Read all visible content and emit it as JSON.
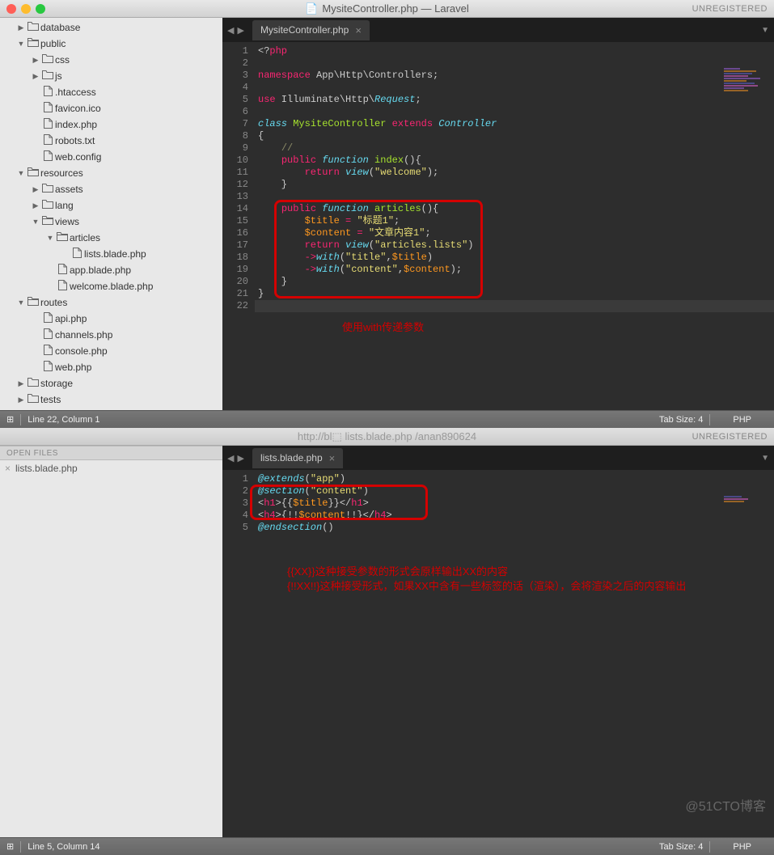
{
  "window1": {
    "title": "MysiteController.php — Laravel",
    "registration": "UNREGISTERED",
    "tab": "MysiteController.php",
    "statusbar": {
      "pos": "Line 22, Column 1",
      "tabsize": "Tab Size: 4",
      "lang": "PHP"
    },
    "annotation": "使用with传递参数",
    "tree": [
      {
        "ind": 1,
        "arrow": "▶",
        "icon": "folder",
        "label": "database"
      },
      {
        "ind": 1,
        "arrow": "▼",
        "icon": "folder-open",
        "label": "public"
      },
      {
        "ind": 2,
        "arrow": "▶",
        "icon": "folder",
        "label": "css"
      },
      {
        "ind": 2,
        "arrow": "▶",
        "icon": "folder",
        "label": "js"
      },
      {
        "ind": 2,
        "arrow": "",
        "icon": "file",
        "label": ".htaccess"
      },
      {
        "ind": 2,
        "arrow": "",
        "icon": "file",
        "label": "favicon.ico"
      },
      {
        "ind": 2,
        "arrow": "",
        "icon": "file",
        "label": "index.php"
      },
      {
        "ind": 2,
        "arrow": "",
        "icon": "file",
        "label": "robots.txt"
      },
      {
        "ind": 2,
        "arrow": "",
        "icon": "file",
        "label": "web.config"
      },
      {
        "ind": 1,
        "arrow": "▼",
        "icon": "folder-open",
        "label": "resources"
      },
      {
        "ind": 2,
        "arrow": "▶",
        "icon": "folder",
        "label": "assets"
      },
      {
        "ind": 2,
        "arrow": "▶",
        "icon": "folder",
        "label": "lang"
      },
      {
        "ind": 2,
        "arrow": "▼",
        "icon": "folder-open",
        "label": "views"
      },
      {
        "ind": 3,
        "arrow": "▼",
        "icon": "folder-open",
        "label": "articles"
      },
      {
        "ind": 4,
        "arrow": "",
        "icon": "file",
        "label": "lists.blade.php"
      },
      {
        "ind": 3,
        "arrow": "",
        "icon": "file",
        "label": "app.blade.php"
      },
      {
        "ind": 3,
        "arrow": "",
        "icon": "file",
        "label": "welcome.blade.php"
      },
      {
        "ind": 1,
        "arrow": "▼",
        "icon": "folder-open",
        "label": "routes"
      },
      {
        "ind": 2,
        "arrow": "",
        "icon": "file",
        "label": "api.php"
      },
      {
        "ind": 2,
        "arrow": "",
        "icon": "file",
        "label": "channels.php"
      },
      {
        "ind": 2,
        "arrow": "",
        "icon": "file",
        "label": "console.php"
      },
      {
        "ind": 2,
        "arrow": "",
        "icon": "file",
        "label": "web.php"
      },
      {
        "ind": 1,
        "arrow": "▶",
        "icon": "folder",
        "label": "storage"
      },
      {
        "ind": 1,
        "arrow": "▶",
        "icon": "folder",
        "label": "tests"
      }
    ],
    "code": {
      "line_count": 22,
      "lines": [
        {
          "n": 1,
          "tokens": [
            {
              "c": "punct",
              "t": "<?"
            },
            {
              "c": "kw-red",
              "t": "php"
            }
          ]
        },
        {
          "n": 2,
          "tokens": []
        },
        {
          "n": 3,
          "tokens": [
            {
              "c": "kw-red",
              "t": "namespace"
            },
            {
              "c": "punct",
              "t": " App\\Http\\Controllers;"
            }
          ]
        },
        {
          "n": 4,
          "tokens": []
        },
        {
          "n": 5,
          "tokens": [
            {
              "c": "kw-red",
              "t": "use"
            },
            {
              "c": "punct",
              "t": " Illuminate\\Http\\"
            },
            {
              "c": "kw-blue",
              "t": "Request"
            },
            {
              "c": "punct",
              "t": ";"
            }
          ]
        },
        {
          "n": 6,
          "tokens": []
        },
        {
          "n": 7,
          "tokens": [
            {
              "c": "kw-blue",
              "t": "class"
            },
            {
              "c": "punct",
              "t": " "
            },
            {
              "c": "kw-green",
              "t": "MysiteController"
            },
            {
              "c": "punct",
              "t": " "
            },
            {
              "c": "kw-red",
              "t": "extends"
            },
            {
              "c": "punct",
              "t": " "
            },
            {
              "c": "kw-blue",
              "t": "Controller"
            }
          ]
        },
        {
          "n": 8,
          "tokens": [
            {
              "c": "punct",
              "t": "{"
            }
          ]
        },
        {
          "n": 9,
          "tokens": [
            {
              "c": "punct",
              "t": "    "
            },
            {
              "c": "comment",
              "t": "//"
            }
          ]
        },
        {
          "n": 10,
          "tokens": [
            {
              "c": "punct",
              "t": "    "
            },
            {
              "c": "kw-red",
              "t": "public"
            },
            {
              "c": "punct",
              "t": " "
            },
            {
              "c": "kw-blue",
              "t": "function"
            },
            {
              "c": "punct",
              "t": " "
            },
            {
              "c": "kw-green",
              "t": "index"
            },
            {
              "c": "punct",
              "t": "(){"
            }
          ]
        },
        {
          "n": 11,
          "tokens": [
            {
              "c": "punct",
              "t": "        "
            },
            {
              "c": "kw-red",
              "t": "return"
            },
            {
              "c": "punct",
              "t": " "
            },
            {
              "c": "kw-blue",
              "t": "view"
            },
            {
              "c": "punct",
              "t": "("
            },
            {
              "c": "str",
              "t": "\"welcome\""
            },
            {
              "c": "punct",
              "t": ");"
            }
          ]
        },
        {
          "n": 12,
          "tokens": [
            {
              "c": "punct",
              "t": "    }"
            }
          ]
        },
        {
          "n": 13,
          "tokens": []
        },
        {
          "n": 14,
          "tokens": [
            {
              "c": "punct",
              "t": "    "
            },
            {
              "c": "kw-red",
              "t": "public"
            },
            {
              "c": "punct",
              "t": " "
            },
            {
              "c": "kw-blue",
              "t": "function"
            },
            {
              "c": "punct",
              "t": " "
            },
            {
              "c": "kw-green",
              "t": "articles"
            },
            {
              "c": "punct",
              "t": "(){"
            }
          ]
        },
        {
          "n": 15,
          "tokens": [
            {
              "c": "punct",
              "t": "        "
            },
            {
              "c": "num-var",
              "t": "$title"
            },
            {
              "c": "punct",
              "t": " "
            },
            {
              "c": "kw-red",
              "t": "="
            },
            {
              "c": "punct",
              "t": " "
            },
            {
              "c": "str",
              "t": "\"标题1\""
            },
            {
              "c": "punct",
              "t": ";"
            }
          ]
        },
        {
          "n": 16,
          "tokens": [
            {
              "c": "punct",
              "t": "        "
            },
            {
              "c": "num-var",
              "t": "$content"
            },
            {
              "c": "punct",
              "t": " "
            },
            {
              "c": "kw-red",
              "t": "="
            },
            {
              "c": "punct",
              "t": " "
            },
            {
              "c": "str",
              "t": "\"文章内容1\""
            },
            {
              "c": "punct",
              "t": ";"
            }
          ]
        },
        {
          "n": 17,
          "tokens": [
            {
              "c": "punct",
              "t": "        "
            },
            {
              "c": "kw-red",
              "t": "return"
            },
            {
              "c": "punct",
              "t": " "
            },
            {
              "c": "kw-blue",
              "t": "view"
            },
            {
              "c": "punct",
              "t": "("
            },
            {
              "c": "str",
              "t": "\"articles.lists\""
            },
            {
              "c": "punct",
              "t": ")"
            }
          ]
        },
        {
          "n": 18,
          "tokens": [
            {
              "c": "punct",
              "t": "        "
            },
            {
              "c": "kw-red",
              "t": "->"
            },
            {
              "c": "kw-blue",
              "t": "with"
            },
            {
              "c": "punct",
              "t": "("
            },
            {
              "c": "str",
              "t": "\"title\""
            },
            {
              "c": "punct",
              "t": ","
            },
            {
              "c": "num-var",
              "t": "$title"
            },
            {
              "c": "punct",
              "t": ")"
            }
          ]
        },
        {
          "n": 19,
          "tokens": [
            {
              "c": "punct",
              "t": "        "
            },
            {
              "c": "kw-red",
              "t": "->"
            },
            {
              "c": "kw-blue",
              "t": "with"
            },
            {
              "c": "punct",
              "t": "("
            },
            {
              "c": "str",
              "t": "\"content\""
            },
            {
              "c": "punct",
              "t": ","
            },
            {
              "c": "num-var",
              "t": "$content"
            },
            {
              "c": "punct",
              "t": ");"
            }
          ]
        },
        {
          "n": 20,
          "tokens": [
            {
              "c": "punct",
              "t": "    }"
            }
          ]
        },
        {
          "n": 21,
          "tokens": [
            {
              "c": "punct",
              "t": "}"
            }
          ]
        },
        {
          "n": 22,
          "tokens": [],
          "active": true
        }
      ]
    }
  },
  "window2": {
    "title_ghost": "http://bl⬚ lists.blade.php /anan890624",
    "registration": "UNREGISTERED",
    "openfiles_header": "OPEN FILES",
    "openfile": "lists.blade.php",
    "tab": "lists.blade.php",
    "statusbar": {
      "pos": "Line 5, Column 14",
      "tabsize": "Tab Size: 4",
      "lang": "PHP"
    },
    "annotations": [
      "{{XX}}这种接受参数的形式会原样输出XX的内容",
      "{!!XX!!}这种接受形式，如果XX中含有一些标签的话（渲染），会将渲染之后的内容输出"
    ],
    "watermark": "@51CTO博客",
    "code": {
      "line_count": 5,
      "lines": [
        {
          "n": 1,
          "tokens": [
            {
              "c": "kw-blue",
              "t": "@extends"
            },
            {
              "c": "punct",
              "t": "("
            },
            {
              "c": "str",
              "t": "\"app\""
            },
            {
              "c": "punct",
              "t": ")"
            }
          ]
        },
        {
          "n": 2,
          "tokens": [
            {
              "c": "kw-blue",
              "t": "@section"
            },
            {
              "c": "punct",
              "t": "("
            },
            {
              "c": "str",
              "t": "\"content\""
            },
            {
              "c": "punct",
              "t": ")"
            }
          ]
        },
        {
          "n": 3,
          "tokens": [
            {
              "c": "punct",
              "t": "<"
            },
            {
              "c": "tag-red",
              "t": "h1"
            },
            {
              "c": "punct",
              "t": ">{{"
            },
            {
              "c": "num-var",
              "t": "$title"
            },
            {
              "c": "punct",
              "t": "}}</"
            },
            {
              "c": "tag-red",
              "t": "h1"
            },
            {
              "c": "punct",
              "t": ">"
            }
          ]
        },
        {
          "n": 4,
          "tokens": [
            {
              "c": "punct",
              "t": "<"
            },
            {
              "c": "tag-red",
              "t": "h4"
            },
            {
              "c": "punct",
              "t": ">{!!"
            },
            {
              "c": "num-var",
              "t": "$content"
            },
            {
              "c": "punct",
              "t": "!!}</"
            },
            {
              "c": "tag-red",
              "t": "h4"
            },
            {
              "c": "punct",
              "t": ">"
            }
          ]
        },
        {
          "n": 5,
          "tokens": [
            {
              "c": "kw-blue",
              "t": "@endsection"
            },
            {
              "c": "punct",
              "t": "()"
            }
          ]
        }
      ]
    }
  },
  "icons": {
    "doc": "📄",
    "close": "×"
  }
}
